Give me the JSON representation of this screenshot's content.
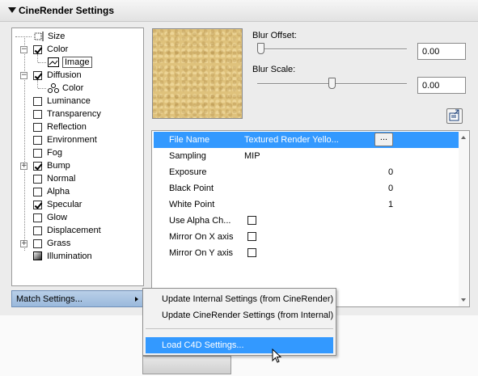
{
  "panel": {
    "title": "CineRender Settings"
  },
  "tree": {
    "items": [
      {
        "label": "Size",
        "checked": false,
        "icon": "size-icon"
      },
      {
        "label": "Color",
        "checked": true
      },
      {
        "label": "Image",
        "icon": "image-icon",
        "selected": true
      },
      {
        "label": "Diffusion",
        "checked": true
      },
      {
        "label": "Color",
        "icon": "color-circles-icon"
      },
      {
        "label": "Luminance",
        "checked": false
      },
      {
        "label": "Transparency",
        "checked": false
      },
      {
        "label": "Reflection",
        "checked": false
      },
      {
        "label": "Environment",
        "checked": false
      },
      {
        "label": "Fog",
        "checked": false
      },
      {
        "label": "Bump",
        "checked": true
      },
      {
        "label": "Normal",
        "checked": false
      },
      {
        "label": "Alpha",
        "checked": false
      },
      {
        "label": "Specular",
        "checked": true
      },
      {
        "label": "Glow",
        "checked": false
      },
      {
        "label": "Displacement",
        "checked": false
      },
      {
        "label": "Grass",
        "checked": false
      },
      {
        "label": "Illumination",
        "icon": "illumination-icon"
      }
    ]
  },
  "match_settings": {
    "label": "Match Settings..."
  },
  "blur": {
    "offset_label": "Blur Offset:",
    "offset_value": "0.00",
    "offset_level": 0.0,
    "scale_label": "Blur Scale:",
    "scale_value": "0.00",
    "scale_level": 0.5
  },
  "props": {
    "rows": [
      {
        "name": "File Name",
        "value": "Textured Render Yello...",
        "selected": true,
        "has_button": true,
        "button_label": "..."
      },
      {
        "name": "Sampling",
        "value": "MIP"
      },
      {
        "name": "Exposure",
        "number": "0"
      },
      {
        "name": "Black Point",
        "number": "0"
      },
      {
        "name": "White Point",
        "number": "1"
      },
      {
        "name": "Use Alpha Ch...",
        "checkbox": true
      },
      {
        "name": "Mirror On X axis",
        "checkbox": true
      },
      {
        "name": "Mirror On Y axis",
        "checkbox": true
      }
    ]
  },
  "menu": {
    "items": [
      {
        "label": "Update Internal Settings (from CineRender)"
      },
      {
        "label": "Update CineRender Settings (from Internal)"
      },
      {
        "label": "Load C4D Settings...",
        "highlighted": true
      }
    ]
  },
  "colors": {
    "accent": "#3399ff",
    "texture": "#dfc27c"
  }
}
